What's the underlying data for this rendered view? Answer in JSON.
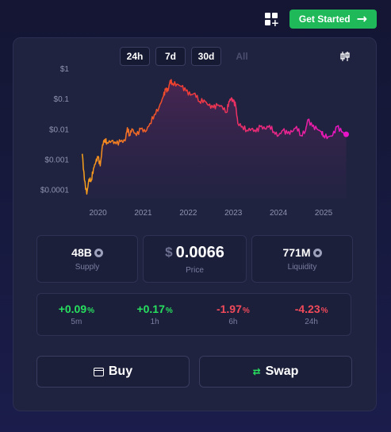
{
  "header": {
    "cta_label": "Get Started"
  },
  "ranges": [
    {
      "label": "24h",
      "enabled": true
    },
    {
      "label": "7d",
      "enabled": true
    },
    {
      "label": "30d",
      "enabled": true
    },
    {
      "label": "All",
      "enabled": false
    }
  ],
  "stats": {
    "supply": {
      "value": "48B",
      "label": "Supply"
    },
    "price": {
      "currency": "$",
      "value": "0.0066",
      "label": "Price"
    },
    "liquidity": {
      "value": "771M",
      "label": "Liquidity"
    }
  },
  "changes": [
    {
      "value": "+0.09",
      "unit": "%",
      "period": "5m",
      "direction": "up"
    },
    {
      "value": "+0.17",
      "unit": "%",
      "period": "1h",
      "direction": "up"
    },
    {
      "value": "-1.97",
      "unit": "%",
      "period": "6h",
      "direction": "down"
    },
    {
      "value": "-4.23",
      "unit": "%",
      "period": "24h",
      "direction": "down"
    }
  ],
  "actions": {
    "buy_label": "Buy",
    "swap_label": "Swap"
  },
  "colors": {
    "accent_green": "#1fb95a",
    "positive": "#27e05f",
    "negative": "#f04a5b",
    "line_start": "#f7a21b",
    "line_mid": "#f0402e",
    "line_end": "#e814c8"
  },
  "chart_data": {
    "type": "line",
    "y_scale": "log",
    "ylim": [
      5e-05,
      1
    ],
    "y_ticks": [
      1,
      0.1,
      0.01,
      0.001,
      0.0001
    ],
    "y_tick_labels": [
      "$1",
      "$0.1",
      "$0.01",
      "$0.001",
      "$0.0001"
    ],
    "x_ticks": [
      2020,
      2021,
      2022,
      2023,
      2024,
      2025
    ],
    "x_tick_labels": [
      "2020",
      "2021",
      "2022",
      "2023",
      "2024",
      "2025"
    ],
    "xlim": [
      2019.55,
      2025.65
    ],
    "grid": false,
    "series": [
      {
        "points": [
          [
            2019.65,
            0.0015
          ],
          [
            2019.7,
            0.0002
          ],
          [
            2019.75,
            7e-05
          ],
          [
            2019.8,
            0.00022
          ],
          [
            2019.85,
            0.0002
          ],
          [
            2019.9,
            0.0005
          ],
          [
            2019.95,
            0.0008
          ],
          [
            2020.0,
            0.0012
          ],
          [
            2020.05,
            0.0006
          ],
          [
            2020.1,
            0.003
          ],
          [
            2020.15,
            0.0045
          ],
          [
            2020.2,
            0.0035
          ],
          [
            2020.3,
            0.004
          ],
          [
            2020.4,
            0.0032
          ],
          [
            2020.5,
            0.0038
          ],
          [
            2020.6,
            0.004
          ],
          [
            2020.65,
            0.011
          ],
          [
            2020.7,
            0.006
          ],
          [
            2020.75,
            0.01
          ],
          [
            2020.85,
            0.006
          ],
          [
            2020.95,
            0.01
          ],
          [
            2021.05,
            0.008
          ],
          [
            2021.15,
            0.015
          ],
          [
            2021.25,
            0.03
          ],
          [
            2021.35,
            0.05
          ],
          [
            2021.45,
            0.12
          ],
          [
            2021.5,
            0.2
          ],
          [
            2021.55,
            0.18
          ],
          [
            2021.6,
            0.4
          ],
          [
            2021.65,
            0.32
          ],
          [
            2021.75,
            0.3
          ],
          [
            2021.85,
            0.25
          ],
          [
            2021.95,
            0.18
          ],
          [
            2022.05,
            0.13
          ],
          [
            2022.15,
            0.15
          ],
          [
            2022.25,
            0.08
          ],
          [
            2022.35,
            0.09
          ],
          [
            2022.45,
            0.06
          ],
          [
            2022.55,
            0.05
          ],
          [
            2022.65,
            0.06
          ],
          [
            2022.75,
            0.055
          ],
          [
            2022.85,
            0.035
          ],
          [
            2022.9,
            0.08
          ],
          [
            2022.95,
            0.1
          ],
          [
            2023.0,
            0.08
          ],
          [
            2023.05,
            0.06
          ],
          [
            2023.1,
            0.015
          ],
          [
            2023.2,
            0.012
          ],
          [
            2023.3,
            0.009
          ],
          [
            2023.4,
            0.01
          ],
          [
            2023.5,
            0.008
          ],
          [
            2023.6,
            0.012
          ],
          [
            2023.7,
            0.01
          ],
          [
            2023.8,
            0.013
          ],
          [
            2023.9,
            0.008
          ],
          [
            2024.0,
            0.006
          ],
          [
            2024.1,
            0.009
          ],
          [
            2024.2,
            0.007
          ],
          [
            2024.3,
            0.008
          ],
          [
            2024.4,
            0.012
          ],
          [
            2024.5,
            0.006
          ],
          [
            2024.6,
            0.009
          ],
          [
            2024.65,
            0.02
          ],
          [
            2024.75,
            0.012
          ],
          [
            2024.85,
            0.01
          ],
          [
            2024.95,
            0.008
          ],
          [
            2025.0,
            0.006
          ],
          [
            2025.1,
            0.0055
          ],
          [
            2025.2,
            0.006
          ],
          [
            2025.3,
            0.012
          ],
          [
            2025.4,
            0.008
          ],
          [
            2025.5,
            0.0066
          ]
        ]
      }
    ]
  }
}
